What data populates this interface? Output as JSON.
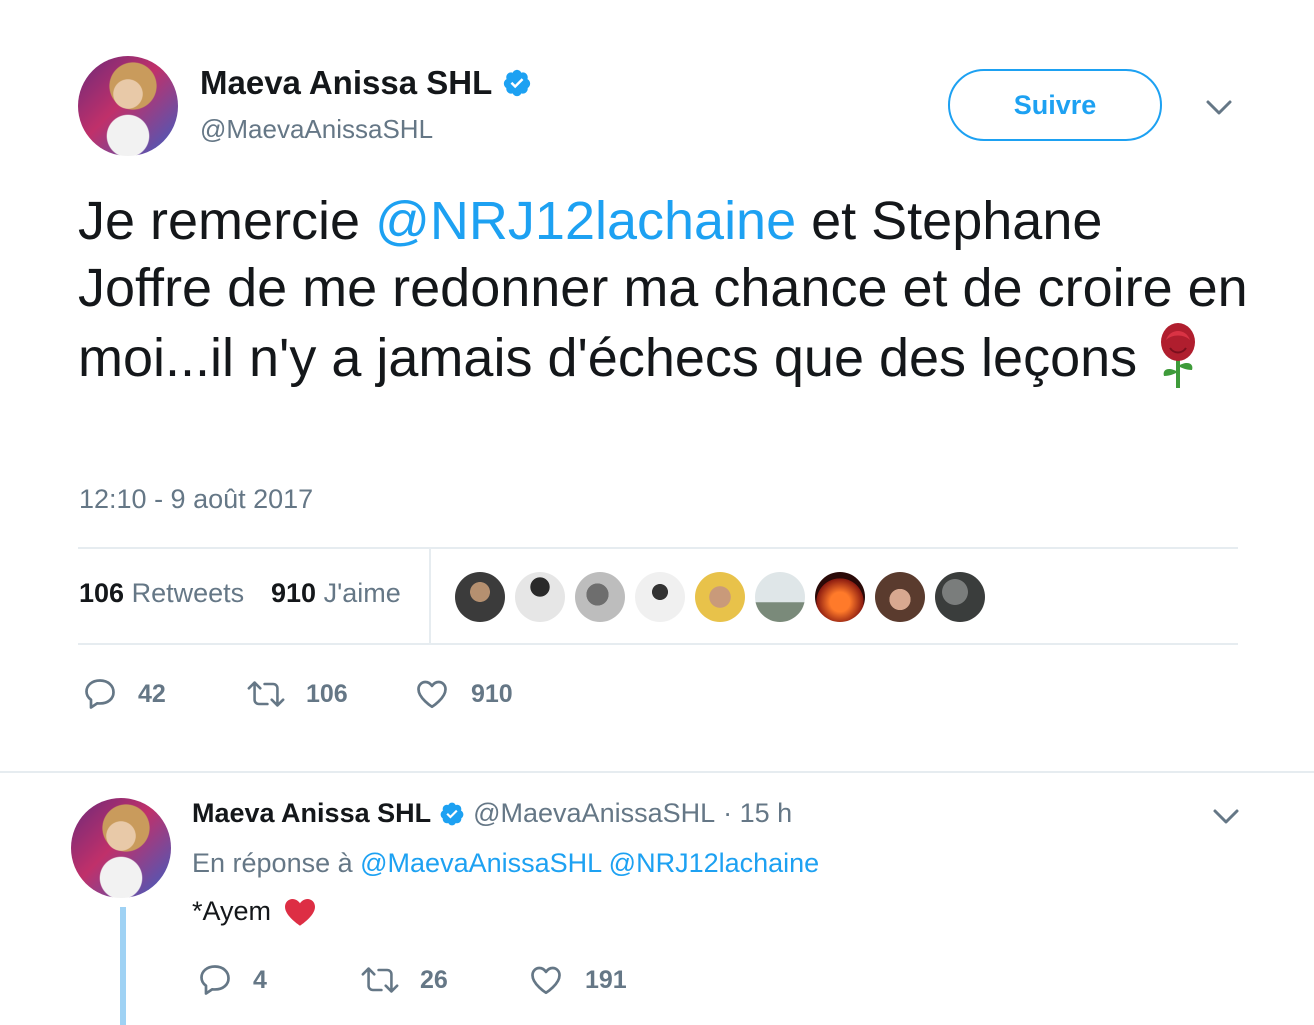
{
  "tweet": {
    "author_name": "Maeva Anissa SHL",
    "author_handle": "@MaevaAnissaSHL",
    "follow_label": "Suivre",
    "text_part1": "Je remercie ",
    "mention1": "@NRJ12lachaine",
    "text_part2": " et Stephane Joffre de me redonner ma chance et de croire en moi...il n'y a jamais d'échecs que des leçons ",
    "emoji": "🌹",
    "timestamp": "12:10 - 9 août 2017",
    "retweets_count": "106",
    "retweets_label": "Retweets",
    "likes_count": "910",
    "likes_label": "J'aime",
    "actions": {
      "reply_count": "42",
      "retweet_count": "106",
      "like_count": "910"
    }
  },
  "likers": [
    {
      "color": "#3b3b3b"
    },
    {
      "color": "#d9d9d9"
    },
    {
      "color": "#9a9a9a"
    },
    {
      "color": "#c8c8c8"
    },
    {
      "color": "#d6b25a"
    },
    {
      "color": "#b7c4c8"
    },
    {
      "color": "#c4321d"
    },
    {
      "color": "#5a3b2e"
    },
    {
      "color": "#4e5150"
    }
  ],
  "reply": {
    "author_name": "Maeva Anissa SHL",
    "author_handle": "@MaevaAnissaSHL",
    "time": "· 15 h",
    "in_reply_prefix": "En réponse à",
    "in_reply_mention1": "@MaevaAnissaSHL",
    "in_reply_mention2": "@NRJ12lachaine",
    "text": "*Ayem",
    "emoji": "❤️",
    "actions": {
      "reply_count": "4",
      "retweet_count": "26",
      "like_count": "191"
    }
  },
  "colors": {
    "accent": "#1da1f2",
    "secondary_text": "#657786",
    "divider": "#e6ecf0"
  }
}
